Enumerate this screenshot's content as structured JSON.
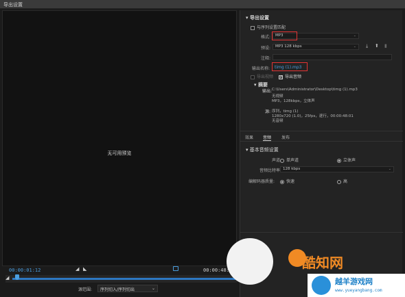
{
  "window": {
    "title": "导出设置"
  },
  "preview": {
    "no_preview": "无可用预览"
  },
  "timeline": {
    "current_tc": "00:00:01:12",
    "end_tc": "00:00:48:0",
    "playhead_position": 0.02
  },
  "source_range": {
    "label": "源范围:",
    "value": "序列切入/序列切出"
  },
  "export_settings": {
    "header": "导出设置",
    "match_sequence_label": "与序列设置匹配",
    "format_label": "格式:",
    "format_value": "MP3",
    "preset_label": "预设:",
    "preset_value": "MP3 128 kbps",
    "comment_label": "注释:",
    "output_name_label": "输出名称:",
    "output_name_value": "timg (1).mp3",
    "export_video_label": "导出视频",
    "export_audio_label": "导出音频",
    "summary_header": "摘要",
    "output_label": "输出:",
    "output_path": "C:\\Users\\Administrator\\Desktop\\timg (1).mp3",
    "output_video": "无视频",
    "output_audio": "MP3，128kbps，立体声",
    "source_label": "源:",
    "source_name": "序列，timg (1)",
    "source_video": "1280x720 (1.0)，25fps，逐行，00:00:48:01",
    "source_audio": "无音频"
  },
  "tabs": [
    "效果",
    "音频",
    "发布"
  ],
  "audio": {
    "basic_header": "基本音频设置",
    "channels_label": "声道:",
    "mono_label": "单声道",
    "stereo_label": "立体声",
    "bitrate_label": "音频比特率:",
    "bitrate_value": "128 kbps",
    "quality_label": "编解码器质量:",
    "fast_label": "快速",
    "high_label": "高"
  },
  "colors": {
    "accent": "#4a9ee0",
    "highlight_box": "#e53434",
    "background": "#1b1b1b",
    "panel": "#232323"
  },
  "watermark": {
    "brand": "酷知网",
    "site_title": "越羊游戏网",
    "site_url": "www.yueyangbang.com"
  }
}
